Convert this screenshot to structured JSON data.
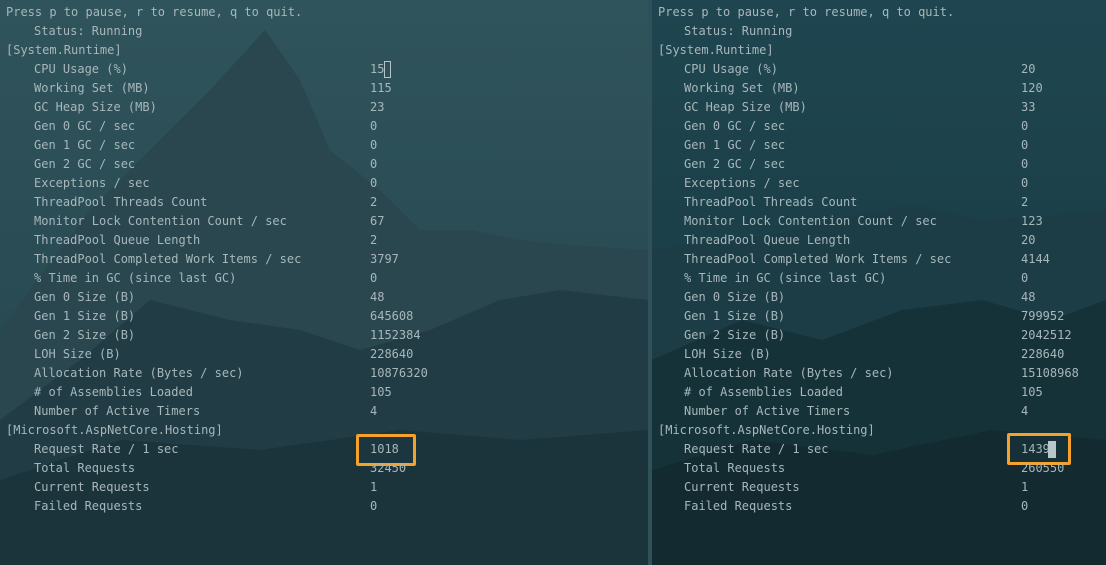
{
  "header": "Press p to pause, r to resume, q to quit.",
  "status_label": "Status: Running",
  "sections": {
    "runtime": "[System.Runtime]",
    "hosting": "[Microsoft.AspNetCore.Hosting]"
  },
  "colors": {
    "highlight": "#f6a12a",
    "text": "#a7b7bb",
    "background": "#1e3c45"
  },
  "left": {
    "runtime_metrics": [
      {
        "name": "CPU Usage (%)",
        "value": "15"
      },
      {
        "name": "Working Set (MB)",
        "value": "115"
      },
      {
        "name": "GC Heap Size (MB)",
        "value": "23"
      },
      {
        "name": "Gen 0 GC / sec",
        "value": "0"
      },
      {
        "name": "Gen 1 GC / sec",
        "value": "0"
      },
      {
        "name": "Gen 2 GC / sec",
        "value": "0"
      },
      {
        "name": "Exceptions / sec",
        "value": "0"
      },
      {
        "name": "ThreadPool Threads Count",
        "value": "2"
      },
      {
        "name": "Monitor Lock Contention Count / sec",
        "value": "67"
      },
      {
        "name": "ThreadPool Queue Length",
        "value": "2"
      },
      {
        "name": "ThreadPool Completed Work Items / sec",
        "value": "3797"
      },
      {
        "name": "% Time in GC (since last GC)",
        "value": "0"
      },
      {
        "name": "Gen 0 Size (B)",
        "value": "48"
      },
      {
        "name": "Gen 1 Size (B)",
        "value": "645608"
      },
      {
        "name": "Gen 2 Size (B)",
        "value": "1152384"
      },
      {
        "name": "LOH Size (B)",
        "value": "228640"
      },
      {
        "name": "Allocation Rate (Bytes / sec)",
        "value": "10876320"
      },
      {
        "name": "# of Assemblies Loaded",
        "value": "105"
      },
      {
        "name": "Number of Active Timers",
        "value": "4"
      }
    ],
    "hosting_metrics": [
      {
        "name": "Request Rate / 1 sec",
        "value": "1018"
      },
      {
        "name": "Total Requests",
        "value": "32450"
      },
      {
        "name": "Current Requests",
        "value": "1"
      },
      {
        "name": "Failed Requests",
        "value": "0"
      }
    ]
  },
  "right": {
    "runtime_metrics": [
      {
        "name": "CPU Usage (%)",
        "value": "20"
      },
      {
        "name": "Working Set (MB)",
        "value": "120"
      },
      {
        "name": "GC Heap Size (MB)",
        "value": "33"
      },
      {
        "name": "Gen 0 GC / sec",
        "value": "0"
      },
      {
        "name": "Gen 1 GC / sec",
        "value": "0"
      },
      {
        "name": "Gen 2 GC / sec",
        "value": "0"
      },
      {
        "name": "Exceptions / sec",
        "value": "0"
      },
      {
        "name": "ThreadPool Threads Count",
        "value": "2"
      },
      {
        "name": "Monitor Lock Contention Count / sec",
        "value": "123"
      },
      {
        "name": "ThreadPool Queue Length",
        "value": "20"
      },
      {
        "name": "ThreadPool Completed Work Items / sec",
        "value": "4144"
      },
      {
        "name": "% Time in GC (since last GC)",
        "value": "0"
      },
      {
        "name": "Gen 0 Size (B)",
        "value": "48"
      },
      {
        "name": "Gen 1 Size (B)",
        "value": "799952"
      },
      {
        "name": "Gen 2 Size (B)",
        "value": "2042512"
      },
      {
        "name": "LOH Size (B)",
        "value": "228640"
      },
      {
        "name": "Allocation Rate (Bytes / sec)",
        "value": "15108968"
      },
      {
        "name": "# of Assemblies Loaded",
        "value": "105"
      },
      {
        "name": "Number of Active Timers",
        "value": "4"
      }
    ],
    "hosting_metrics": [
      {
        "name": "Request Rate / 1 sec",
        "value": "1439"
      },
      {
        "name": "Total Requests",
        "value": "260550"
      },
      {
        "name": "Current Requests",
        "value": "1"
      },
      {
        "name": "Failed Requests",
        "value": "0"
      }
    ]
  }
}
